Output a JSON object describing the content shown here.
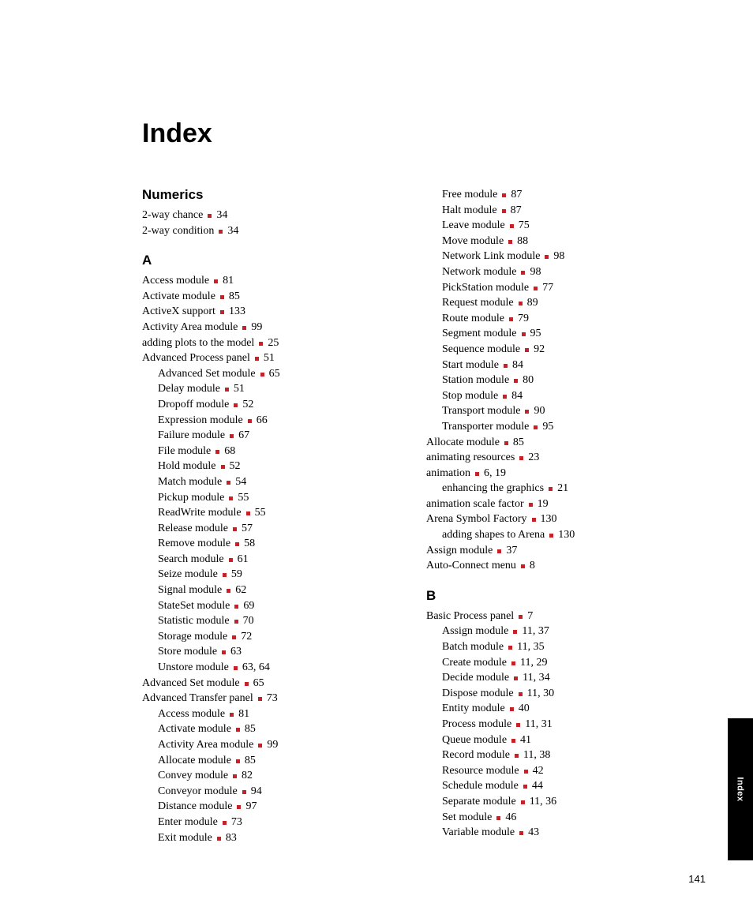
{
  "title": "Index",
  "page_number": "141",
  "side_tab": "Index",
  "left_column": [
    {
      "type": "head",
      "text": "Numerics"
    },
    {
      "type": "entry",
      "term": "2-way chance",
      "pages": "34"
    },
    {
      "type": "entry",
      "term": "2-way condition",
      "pages": "34"
    },
    {
      "type": "head",
      "text": "A"
    },
    {
      "type": "entry",
      "term": "Access module",
      "pages": "81"
    },
    {
      "type": "entry",
      "term": "Activate module",
      "pages": "85"
    },
    {
      "type": "entry",
      "term": "ActiveX support",
      "pages": "133"
    },
    {
      "type": "entry",
      "term": "Activity Area module",
      "pages": "99"
    },
    {
      "type": "entry",
      "term": "adding plots to the model",
      "pages": "25"
    },
    {
      "type": "entry",
      "term": "Advanced Process panel",
      "pages": "51"
    },
    {
      "type": "entry",
      "indent": 1,
      "term": "Advanced Set module",
      "pages": "65"
    },
    {
      "type": "entry",
      "indent": 1,
      "term": "Delay module",
      "pages": "51"
    },
    {
      "type": "entry",
      "indent": 1,
      "term": "Dropoff module",
      "pages": "52"
    },
    {
      "type": "entry",
      "indent": 1,
      "term": "Expression module",
      "pages": "66"
    },
    {
      "type": "entry",
      "indent": 1,
      "term": "Failure module",
      "pages": "67"
    },
    {
      "type": "entry",
      "indent": 1,
      "term": "File module",
      "pages": "68"
    },
    {
      "type": "entry",
      "indent": 1,
      "term": "Hold module",
      "pages": "52"
    },
    {
      "type": "entry",
      "indent": 1,
      "term": "Match module",
      "pages": "54"
    },
    {
      "type": "entry",
      "indent": 1,
      "term": "Pickup module",
      "pages": "55"
    },
    {
      "type": "entry",
      "indent": 1,
      "term": "ReadWrite module",
      "pages": "55"
    },
    {
      "type": "entry",
      "indent": 1,
      "term": "Release module",
      "pages": "57"
    },
    {
      "type": "entry",
      "indent": 1,
      "term": "Remove module",
      "pages": "58"
    },
    {
      "type": "entry",
      "indent": 1,
      "term": "Search module",
      "pages": "61"
    },
    {
      "type": "entry",
      "indent": 1,
      "term": "Seize module",
      "pages": "59"
    },
    {
      "type": "entry",
      "indent": 1,
      "term": "Signal module",
      "pages": "62"
    },
    {
      "type": "entry",
      "indent": 1,
      "term": "StateSet module",
      "pages": "69"
    },
    {
      "type": "entry",
      "indent": 1,
      "term": "Statistic module",
      "pages": "70"
    },
    {
      "type": "entry",
      "indent": 1,
      "term": "Storage module",
      "pages": "72"
    },
    {
      "type": "entry",
      "indent": 1,
      "term": "Store module",
      "pages": "63"
    },
    {
      "type": "entry",
      "indent": 1,
      "term": "Unstore module",
      "pages": "63, 64"
    },
    {
      "type": "entry",
      "term": "Advanced Set module",
      "pages": "65"
    },
    {
      "type": "entry",
      "term": "Advanced Transfer panel",
      "pages": "73"
    },
    {
      "type": "entry",
      "indent": 1,
      "term": "Access module",
      "pages": "81"
    },
    {
      "type": "entry",
      "indent": 1,
      "term": "Activate module",
      "pages": "85"
    },
    {
      "type": "entry",
      "indent": 1,
      "term": "Activity Area module",
      "pages": "99"
    },
    {
      "type": "entry",
      "indent": 1,
      "term": "Allocate module",
      "pages": "85"
    },
    {
      "type": "entry",
      "indent": 1,
      "term": "Convey module",
      "pages": "82"
    },
    {
      "type": "entry",
      "indent": 1,
      "term": "Conveyor module",
      "pages": "94"
    },
    {
      "type": "entry",
      "indent": 1,
      "term": "Distance module",
      "pages": "97"
    },
    {
      "type": "entry",
      "indent": 1,
      "term": "Enter module",
      "pages": "73"
    },
    {
      "type": "entry",
      "indent": 1,
      "term": "Exit module",
      "pages": "83"
    }
  ],
  "right_column": [
    {
      "type": "entry",
      "indent": 1,
      "term": "Free module",
      "pages": "87"
    },
    {
      "type": "entry",
      "indent": 1,
      "term": "Halt module",
      "pages": "87"
    },
    {
      "type": "entry",
      "indent": 1,
      "term": "Leave module",
      "pages": "75"
    },
    {
      "type": "entry",
      "indent": 1,
      "term": "Move module",
      "pages": "88"
    },
    {
      "type": "entry",
      "indent": 1,
      "term": "Network Link module",
      "pages": "98"
    },
    {
      "type": "entry",
      "indent": 1,
      "term": "Network module",
      "pages": "98"
    },
    {
      "type": "entry",
      "indent": 1,
      "term": "PickStation module",
      "pages": "77"
    },
    {
      "type": "entry",
      "indent": 1,
      "term": "Request module",
      "pages": "89"
    },
    {
      "type": "entry",
      "indent": 1,
      "term": "Route module",
      "pages": "79"
    },
    {
      "type": "entry",
      "indent": 1,
      "term": "Segment module",
      "pages": "95"
    },
    {
      "type": "entry",
      "indent": 1,
      "term": "Sequence module",
      "pages": "92"
    },
    {
      "type": "entry",
      "indent": 1,
      "term": "Start module",
      "pages": "84"
    },
    {
      "type": "entry",
      "indent": 1,
      "term": "Station module",
      "pages": "80"
    },
    {
      "type": "entry",
      "indent": 1,
      "term": "Stop module",
      "pages": "84"
    },
    {
      "type": "entry",
      "indent": 1,
      "term": "Transport module",
      "pages": "90"
    },
    {
      "type": "entry",
      "indent": 1,
      "term": "Transporter module",
      "pages": "95"
    },
    {
      "type": "entry",
      "term": "Allocate module",
      "pages": "85"
    },
    {
      "type": "entry",
      "term": "animating resources",
      "pages": "23"
    },
    {
      "type": "entry",
      "term": "animation",
      "pages": "6, 19"
    },
    {
      "type": "entry",
      "indent": 1,
      "term": "enhancing the graphics",
      "pages": "21"
    },
    {
      "type": "entry",
      "term": "animation scale factor",
      "pages": "19"
    },
    {
      "type": "entry",
      "term": "Arena Symbol Factory",
      "pages": "130"
    },
    {
      "type": "entry",
      "indent": 1,
      "term": "adding shapes to Arena",
      "pages": "130"
    },
    {
      "type": "entry",
      "term": "Assign module",
      "pages": "37"
    },
    {
      "type": "entry",
      "term": "Auto-Connect menu",
      "pages": "8"
    },
    {
      "type": "head",
      "text": "B"
    },
    {
      "type": "entry",
      "term": "Basic Process panel",
      "pages": "7"
    },
    {
      "type": "entry",
      "indent": 1,
      "term": "Assign module",
      "pages": "11, 37"
    },
    {
      "type": "entry",
      "indent": 1,
      "term": "Batch module",
      "pages": "11, 35"
    },
    {
      "type": "entry",
      "indent": 1,
      "term": "Create module",
      "pages": "11, 29"
    },
    {
      "type": "entry",
      "indent": 1,
      "term": "Decide module",
      "pages": "11, 34"
    },
    {
      "type": "entry",
      "indent": 1,
      "term": "Dispose module",
      "pages": "11, 30"
    },
    {
      "type": "entry",
      "indent": 1,
      "term": "Entity module",
      "pages": "40"
    },
    {
      "type": "entry",
      "indent": 1,
      "term": "Process module",
      "pages": "11, 31"
    },
    {
      "type": "entry",
      "indent": 1,
      "term": "Queue module",
      "pages": "41"
    },
    {
      "type": "entry",
      "indent": 1,
      "term": "Record module",
      "pages": "11, 38"
    },
    {
      "type": "entry",
      "indent": 1,
      "term": "Resource module",
      "pages": "42"
    },
    {
      "type": "entry",
      "indent": 1,
      "term": "Schedule module",
      "pages": "44"
    },
    {
      "type": "entry",
      "indent": 1,
      "term": "Separate module",
      "pages": "11, 36"
    },
    {
      "type": "entry",
      "indent": 1,
      "term": "Set module",
      "pages": "46"
    },
    {
      "type": "entry",
      "indent": 1,
      "term": "Variable module",
      "pages": "43"
    }
  ]
}
